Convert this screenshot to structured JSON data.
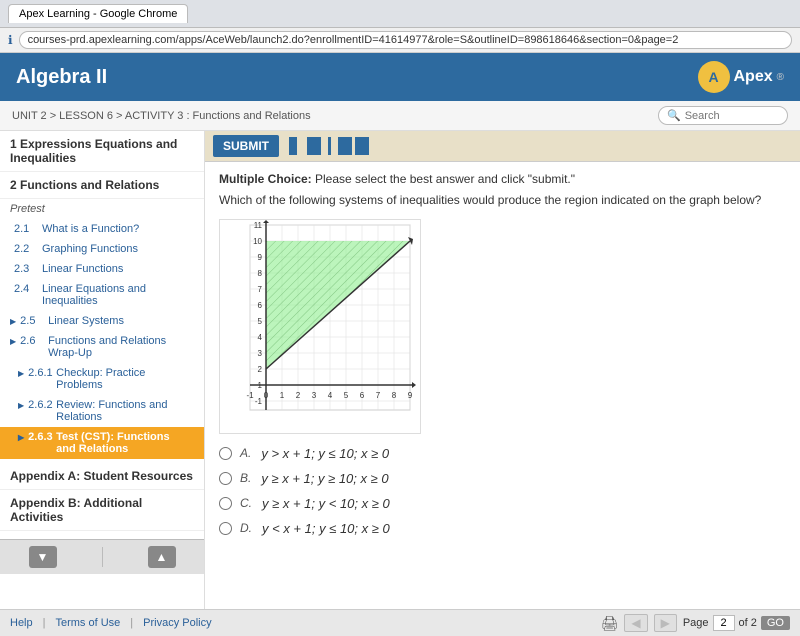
{
  "browser": {
    "title": "Apex Learning - Google Chrome",
    "tab_label": "Apex Learning - Google Chrome",
    "address": "courses-prd.apexlearning.com/apps/AceWeb/launch2.do?enrollmentID=41614977&role=S&outlineID=898618646&section=0&page=2"
  },
  "header": {
    "title": "Algebra II",
    "logo_initial": "A",
    "logo_text": "Apex"
  },
  "subheader": {
    "breadcrumb": "UNIT 2 > LESSON 6 > ACTIVITY 3 : Functions and Relations",
    "search_placeholder": "Search"
  },
  "sidebar": {
    "section1_label": "1   Expressions Equations and Inequalities",
    "section2_label": "2   Functions and Relations",
    "subsection_pretest": "Pretest",
    "items": [
      {
        "id": "2.1",
        "label": "What is a Function?"
      },
      {
        "id": "2.2",
        "label": "Graphing Functions"
      },
      {
        "id": "2.3",
        "label": "Linear Functions"
      },
      {
        "id": "2.4",
        "label": "Linear Equations and Inequalities"
      },
      {
        "id": "2.5",
        "label": "Linear Systems"
      },
      {
        "id": "2.6",
        "label": "Functions and Relations Wrap-Up"
      },
      {
        "id": "2.6.1",
        "label": "Checkup: Practice Problems"
      },
      {
        "id": "2.6.2",
        "label": "Review: Functions and Relations"
      },
      {
        "id": "2.6.3",
        "label": "Test (CST): Functions and Relations",
        "active": true
      }
    ],
    "appendix_a": "Appendix A: Student Resources",
    "appendix_b": "Appendix B: Additional Activities",
    "nav_down": "▼",
    "nav_up": "▲"
  },
  "toolbar": {
    "submit_label": "SUBMIT"
  },
  "content": {
    "question_type_label": "Multiple Choice:",
    "question_type_note": "Please select the best answer and click \"submit.\"",
    "question_text": "Which of the following systems of inequalities would produce the region indicated on the graph below?",
    "choices": [
      {
        "id": "A",
        "math": "y > x + 1; y ≤ 10; x ≥ 0"
      },
      {
        "id": "B",
        "math": "y ≥ x + 1; y ≥ 10; x ≥ 0"
      },
      {
        "id": "C",
        "math": "y ≥ x + 1; y < 10; x ≥ 0"
      },
      {
        "id": "D",
        "math": "y < x + 1; y ≤ 10; x ≥ 0"
      }
    ]
  },
  "graph": {
    "y_max": 11,
    "y_min": -1,
    "x_max": 9,
    "x_min": -1
  },
  "bottom_bar": {
    "help": "Help",
    "terms": "Terms of Use",
    "privacy": "Privacy Policy",
    "page_label": "Page",
    "page_current": "2",
    "page_total": "of 2",
    "go_label": "GO"
  }
}
